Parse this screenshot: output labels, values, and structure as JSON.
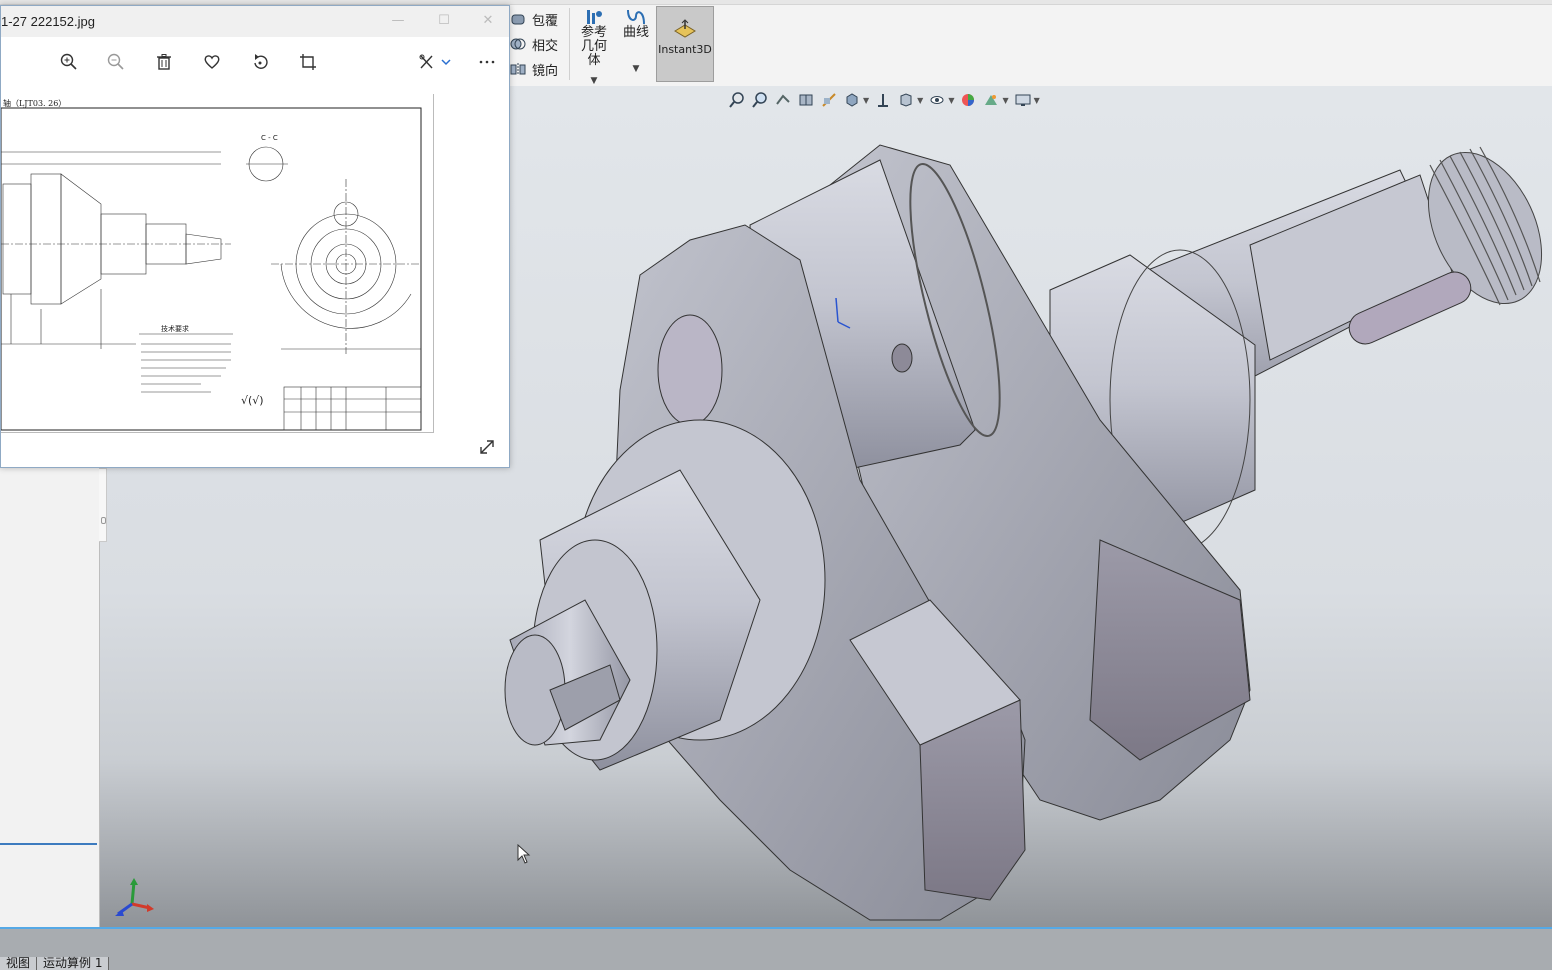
{
  "ribbon": {
    "wrap_label": "包覆",
    "intersect_label": "相交",
    "mirror_label": "镜向",
    "ref_geometry_label": "参考几何体",
    "curves_label": "曲线",
    "instant3d_label": "Instant3D"
  },
  "heads_up_toolbar": {
    "icons": [
      "zoom-to-fit-icon",
      "zoom-to-area-icon",
      "previous-view-icon",
      "section-view-icon",
      "dynamic-annotation-icon",
      "view-orientation-icon",
      "display-style-icon",
      "hide-show-icon",
      "edit-appearance-icon",
      "apply-scene-icon",
      "view-settings-icon"
    ]
  },
  "viewer": {
    "title": "1-27 222152.jpg",
    "toolbar_icons": [
      "zoom-in-icon",
      "zoom-out-icon",
      "delete-icon",
      "favorite-icon",
      "rotate-icon",
      "crop-icon",
      "edit-icon",
      "more-icon"
    ],
    "drawing": {
      "header": "轴（LJT03. 26）",
      "section_label": "C - C",
      "notes_title": "技术要求",
      "roughness_symbol": "√(√)"
    }
  },
  "bottom_tabs": [
    "视图",
    "运动算例 1"
  ],
  "colors": {
    "accent_blue": "#55a9e6",
    "ribbon_bg": "#f3f3f3",
    "instant3d_active": "#c9c9c9",
    "part_gray": "#b7b9c4"
  }
}
